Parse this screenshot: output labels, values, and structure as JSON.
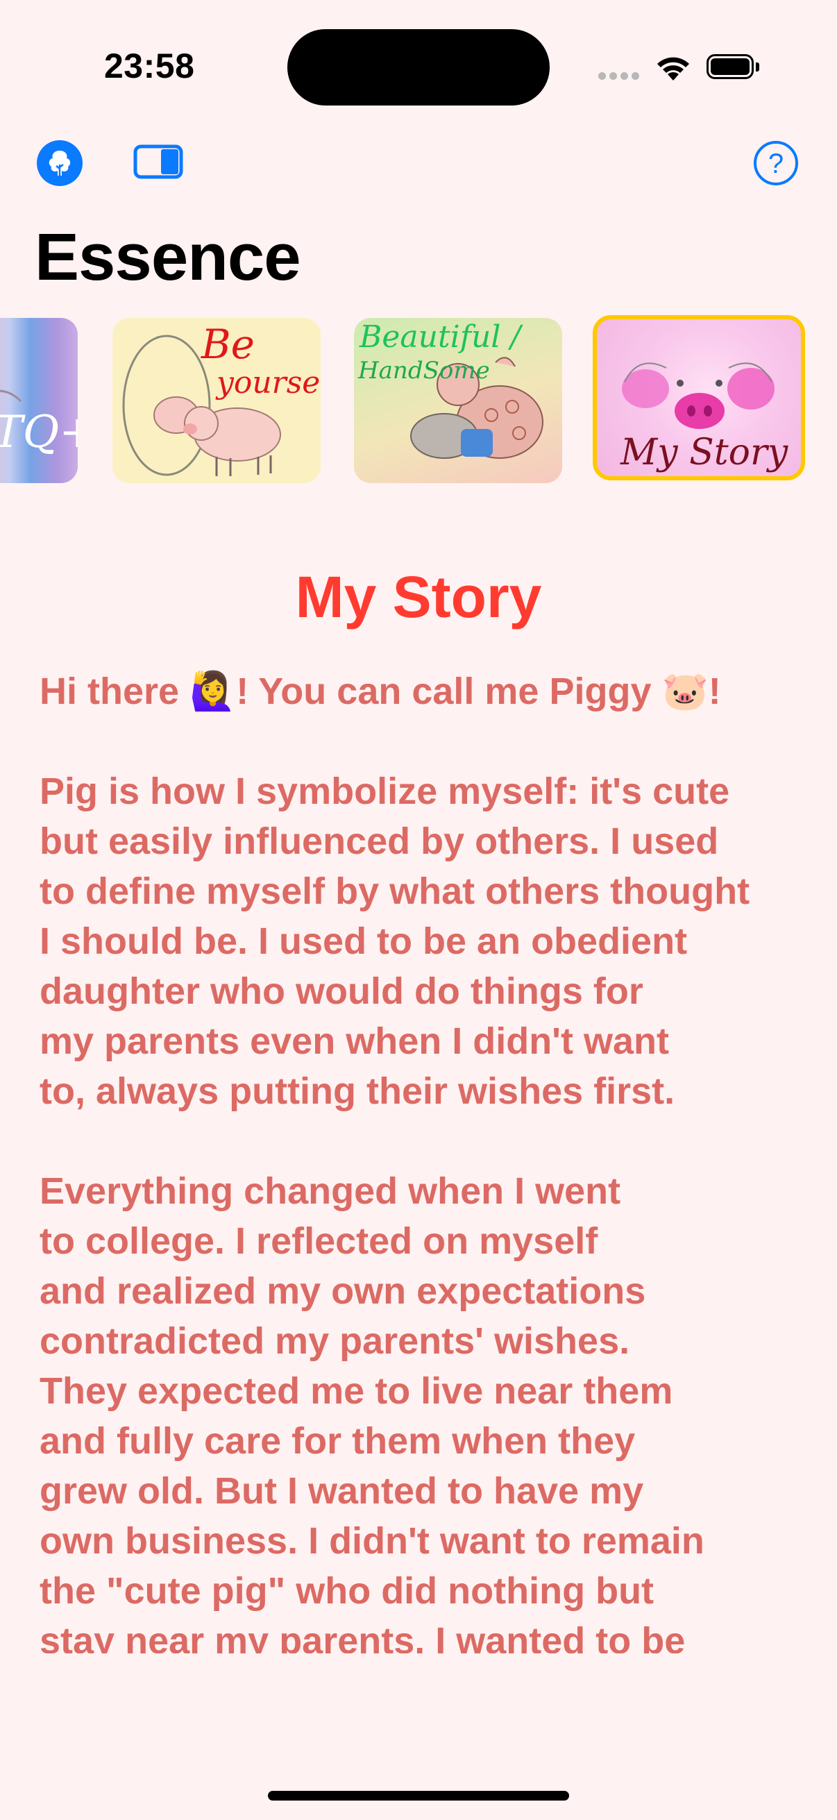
{
  "status_bar": {
    "time": "23:58"
  },
  "toolbar": {
    "tree_icon": "tree-icon",
    "sidebar_icon": "sidebar-toggle-icon",
    "help_icon": "question-circle-icon",
    "help_glyph": "?",
    "accent_color": "#0a7aff"
  },
  "page": {
    "title": "Essence"
  },
  "carousel": {
    "cards": [
      {
        "id": "lgbtq",
        "text": "TQ+"
      },
      {
        "id": "be-yourself",
        "text_line1": "Be",
        "text_line2": "yourself"
      },
      {
        "id": "beautiful",
        "text_line1": "Beautiful /",
        "text_line2": "HandSome"
      },
      {
        "id": "my-story",
        "text": "My Story",
        "selected": true
      }
    ],
    "selected_border_color": "#ffc800"
  },
  "story": {
    "title": "My Story",
    "title_color": "#ff3b30",
    "text_color": "#dc6a64",
    "paragraphs": [
      "Hi there 🙋‍♀️! You can call me Piggy 🐷!",
      "Pig is how I symbolize myself: it's cute\nbut easily influenced by others. I used\nto define myself by what others thought\nI should be. I used to be an obedient\ndaughter who would do things for\nmy parents even when I didn't want\nto, always putting their wishes first.",
      "Everything changed when I went\nto college. I reflected on myself\nand realized my own expectations\ncontradicted my parents' wishes.\nThey expected me to live near them\nand fully care for them when they\ngrew old. But I wanted to have my\nown business. I didn't want to remain\nthe \"cute pig\" who did nothing but\nstay near my parents. I wanted to be"
    ]
  }
}
